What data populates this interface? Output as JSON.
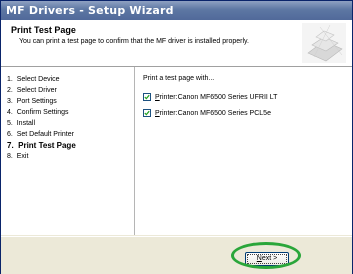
{
  "window": {
    "title": "MF Drivers - Setup Wizard"
  },
  "header": {
    "title": "Print Test Page",
    "description": "You can print a test page to confirm that the MF driver is installed properly."
  },
  "steps": [
    {
      "num": "1.",
      "label": "Select Device"
    },
    {
      "num": "2.",
      "label": "Select Driver"
    },
    {
      "num": "3.",
      "label": "Port Settings"
    },
    {
      "num": "4.",
      "label": "Confirm Settings"
    },
    {
      "num": "5.",
      "label": "Install"
    },
    {
      "num": "6.",
      "label": "Set Default Printer"
    },
    {
      "num": "7.",
      "label": "Print Test Page"
    },
    {
      "num": "8.",
      "label": "Exit"
    }
  ],
  "active_step_index": 6,
  "content": {
    "prompt": "Print a test page with...",
    "printers": [
      {
        "prefix_underlined": "P",
        "prefix_rest": "rinter:",
        "name": "Canon MF6500 Series UFRII LT",
        "checked": true
      },
      {
        "prefix_underlined": "P",
        "prefix_rest": "rinter:",
        "name": "Canon MF6500 Series PCL5e",
        "checked": true
      }
    ]
  },
  "footer": {
    "next_label_underlined": "N",
    "next_label_rest": "ext >"
  },
  "colors": {
    "highlight_ellipse": "#2aa63a",
    "titlebar": "#5d77a3"
  }
}
